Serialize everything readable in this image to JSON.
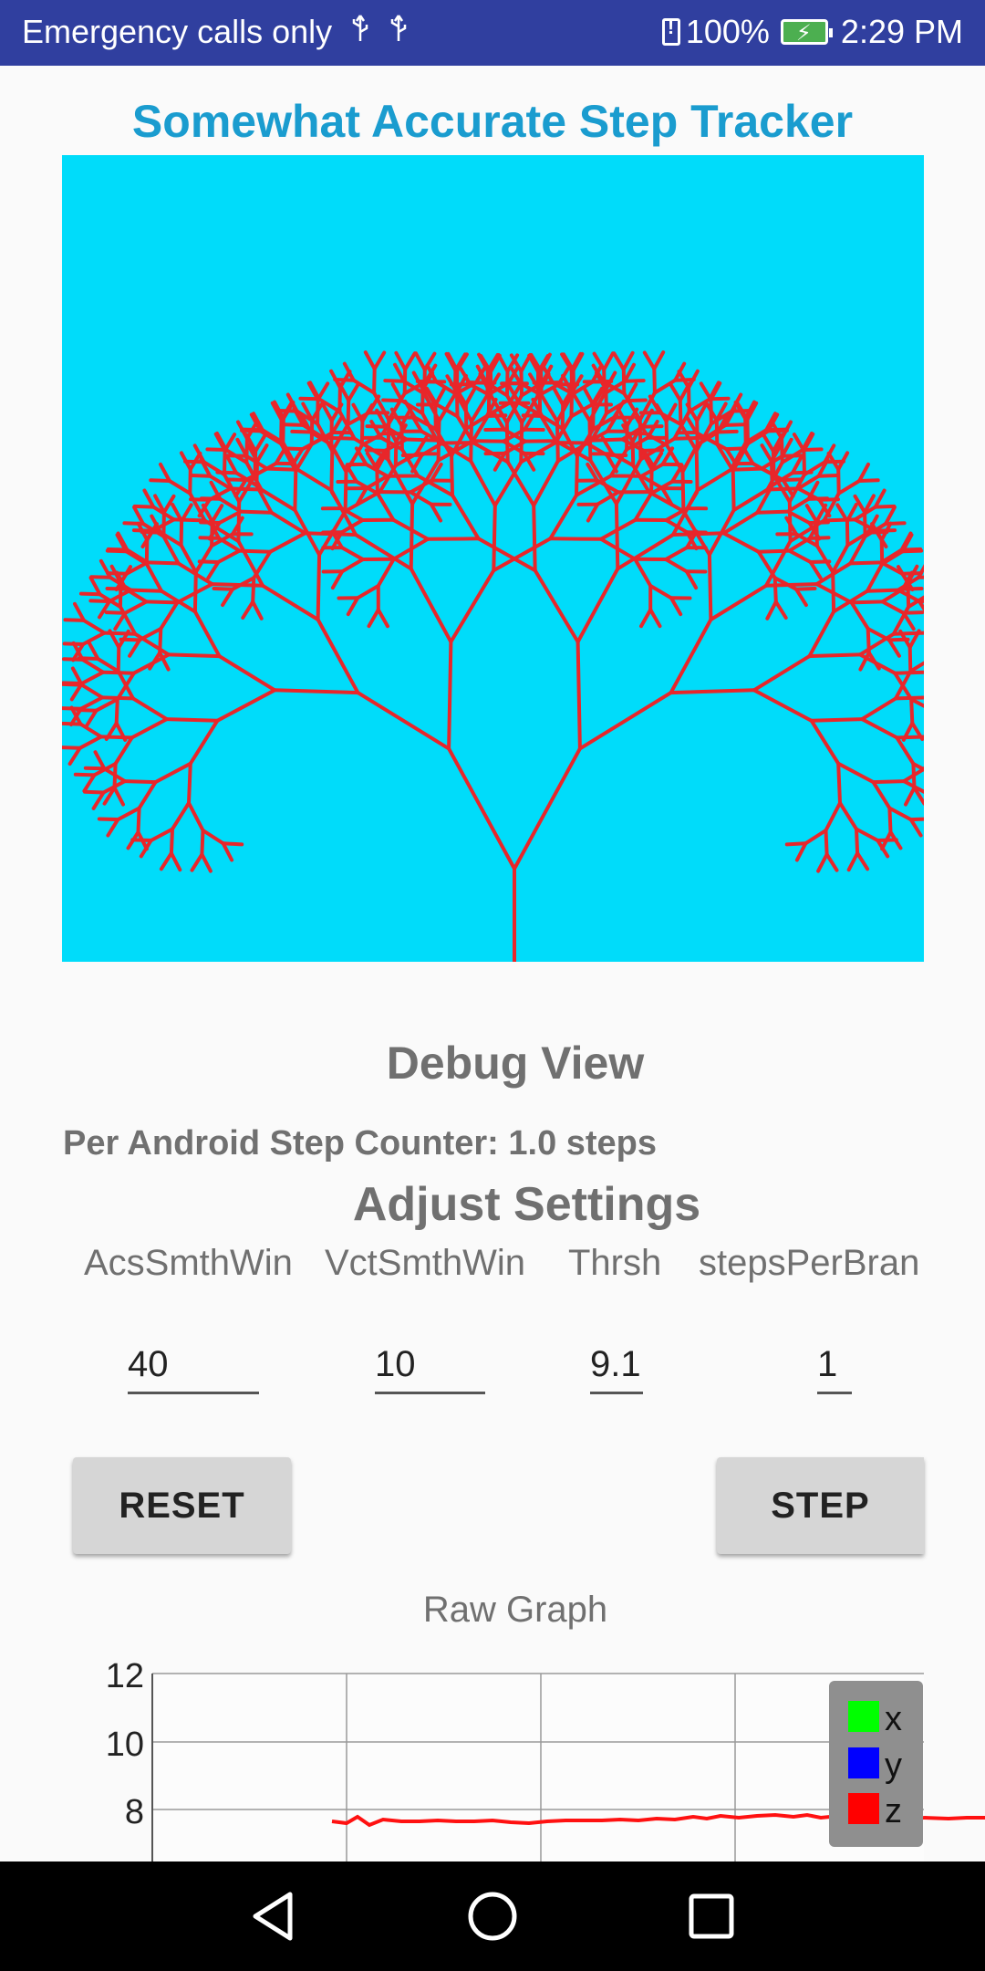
{
  "status_bar": {
    "carrier_text": "Emergency calls only",
    "usb_icons": [
      "usb-icon",
      "usb-icon"
    ],
    "battery_percent": "100%",
    "battery_level": 1.0,
    "time": "2:29 PM"
  },
  "app": {
    "title": "Somewhat Accurate Step Tracker",
    "tree_background": "#00dcfa",
    "tree_color": "#e8262a"
  },
  "debug": {
    "title": "Debug View",
    "step_counter": "Per Android Step Counter: 1.0 steps"
  },
  "settings": {
    "title": "Adjust Settings",
    "columns": [
      {
        "label": "AcsSmthWin",
        "value": "40"
      },
      {
        "label": "VctSmthWin",
        "value": "10"
      },
      {
        "label": "Thrsh",
        "value": "9.1"
      },
      {
        "label": "stepsPerBran",
        "value": "1"
      }
    ],
    "reset_label": "RESET",
    "step_label": "STEP"
  },
  "graph": {
    "title": "Raw Graph",
    "y_ticks": [
      "12",
      "10",
      "8"
    ],
    "legend": [
      {
        "label": "x",
        "color": "#00ff00"
      },
      {
        "label": "y",
        "color": "#0000ff"
      },
      {
        "label": "z",
        "color": "#ff0000"
      }
    ]
  },
  "nav": {
    "back_icon": "back-icon",
    "home_icon": "home-icon",
    "recents_icon": "recents-icon"
  }
}
